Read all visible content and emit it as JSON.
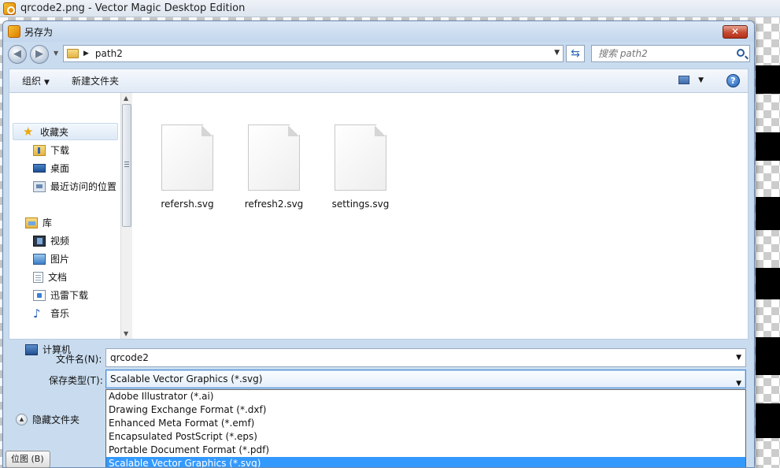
{
  "app": {
    "title": "qrcode2.png - Vector Magic Desktop Edition"
  },
  "dialog": {
    "title": "另存为",
    "close_label": "✕"
  },
  "address": {
    "path": "path2",
    "search_placeholder": "搜索 path2"
  },
  "toolbar": {
    "organize": "组织",
    "new_folder": "新建文件夹",
    "help": "?"
  },
  "sidebar": {
    "favorites": "收藏夹",
    "downloads": "下载",
    "desktop": "桌面",
    "recent": "最近访问的位置",
    "libraries": "库",
    "videos": "视频",
    "pictures": "图片",
    "documents": "文档",
    "xunlei": "迅雷下载",
    "music": "音乐",
    "computer": "计算机"
  },
  "files": [
    {
      "name": "refersh.svg"
    },
    {
      "name": "refresh2.svg"
    },
    {
      "name": "settings.svg"
    }
  ],
  "filename": {
    "label": "文件名(N):",
    "value": "qrcode2"
  },
  "filetype": {
    "label": "保存类型(T):",
    "selected": "Scalable Vector Graphics (*.svg)",
    "options": [
      "Adobe Illustrator (*.ai)",
      "Drawing Exchange Format (*.dxf)",
      "Enhanced Meta Format (*.emf)",
      "Encapsulated PostScript (*.eps)",
      "Portable Document Format (*.pdf)",
      "Scalable Vector Graphics (*.svg)"
    ]
  },
  "hide_folders": "隐藏文件夹",
  "taskbar": {
    "label": "位图 (B)"
  },
  "colors": {
    "dialog_bg": "#c9dcef",
    "selection": "#3399ff",
    "close": "#c44a30"
  }
}
